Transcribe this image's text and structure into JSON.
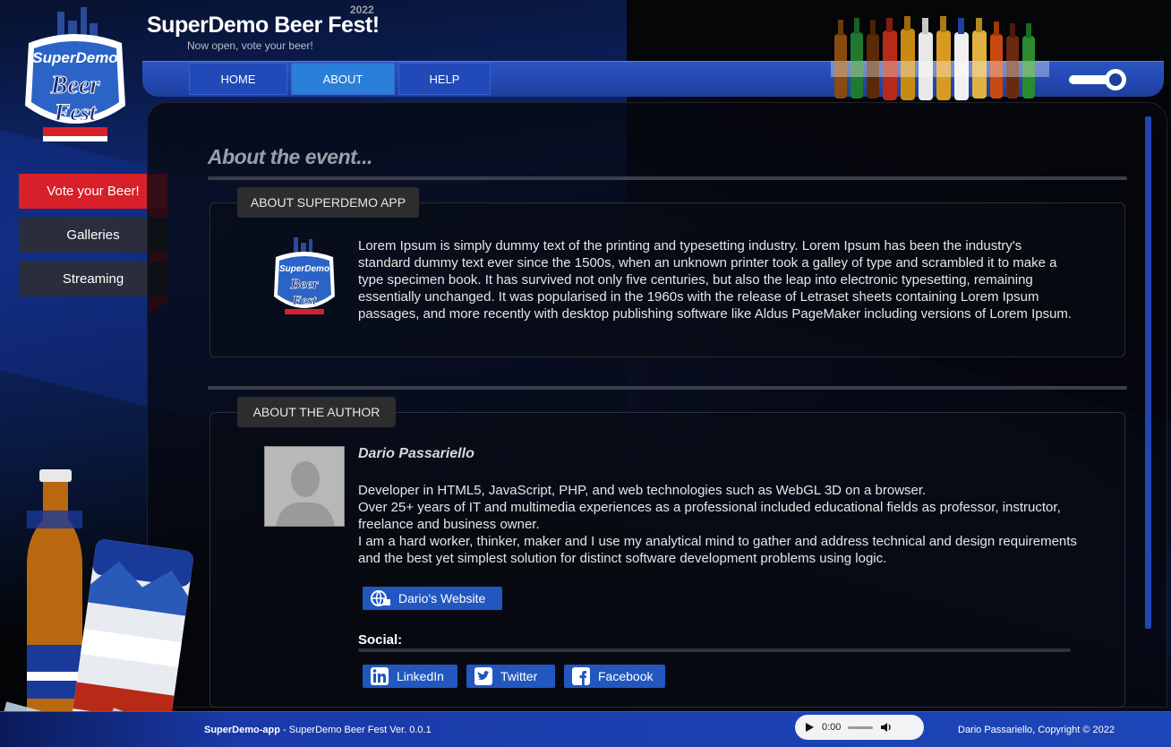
{
  "header": {
    "title": "SuperDemo Beer Fest!",
    "year": "2022",
    "subtitle": "Now open, vote your beer!",
    "logo_text_top": "SuperDemo",
    "logo_text_mid": "Beer",
    "logo_text_bottom": "Fest"
  },
  "nav": {
    "items": [
      {
        "label": "HOME",
        "active": false
      },
      {
        "label": "ABOUT",
        "active": true
      },
      {
        "label": "HELP",
        "active": false
      }
    ]
  },
  "sidebar": {
    "items": [
      {
        "label": "Vote your Beer!"
      },
      {
        "label": "Galleries"
      },
      {
        "label": "Streaming"
      }
    ]
  },
  "main": {
    "title": "About the event...",
    "app_section": {
      "tab_label": "ABOUT SUPERDEMO APP",
      "text": "Lorem Ipsum is simply dummy text of the printing and typesetting industry. Lorem Ipsum has been the industry's standard dummy text ever since the 1500s, when an unknown printer took a galley of type and scrambled it to make a type specimen book. It has survived not only five centuries, but also the leap into electronic typesetting, remaining essentially unchanged. It was popularised in the 1960s with the release of Letraset sheets containing Lorem Ipsum passages, and more recently with desktop publishing software like Aldus PageMaker including versions of Lorem Ipsum."
    },
    "author_section": {
      "tab_label": "ABOUT THE AUTHOR",
      "name": "Dario Passariello",
      "bio_line1": "Developer in HTML5, JavaScript, PHP, and web technologies such as WebGL 3D on a browser.",
      "bio_line2": "Over 25+ years of IT and multimedia experiences as a professional included educational fields as professor, instructor, freelance and business owner.",
      "bio_line3": "I am a hard worker, thinker, maker and I use my analytical mind to gather and address technical and design requirements and the best yet simplest solution for distinct software development problems using logic.",
      "website_label": "Dario's Website",
      "social_label": "Social:",
      "social": [
        {
          "label": "LinkedIn",
          "icon": "linkedin-icon"
        },
        {
          "label": "Twitter",
          "icon": "twitter-icon"
        },
        {
          "label": "Facebook",
          "icon": "facebook-icon"
        }
      ]
    }
  },
  "footer": {
    "app_name": "SuperDemo-app",
    "version_text": " - SuperDemo Beer Fest Ver. 0.0.1",
    "audio_time": "0:00",
    "copyright": "Dario Passariello, Copyright © 2022"
  },
  "colors": {
    "accent_blue": "#2249b8",
    "vote_red": "#d8202a",
    "dark_panel": "#06080e"
  }
}
